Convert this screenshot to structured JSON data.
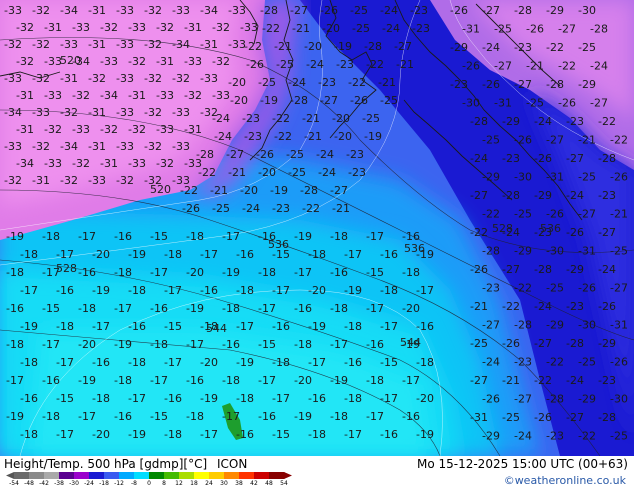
{
  "title_left": "Height/Temp. 500 hPa [gdmp][°C]",
  "model_name": "ICON",
  "title_right": "Mo 15-12-2025 15:00 UTC (00+63)",
  "credit": "©weatheronline.co.uk",
  "colorbar": {
    "ticks": [
      "-54",
      "-48",
      "-42",
      "-38",
      "-30",
      "-24",
      "-18",
      "-12",
      "-8",
      "0",
      "8",
      "12",
      "18",
      "24",
      "30",
      "38",
      "42",
      "48",
      "54"
    ],
    "colors": [
      "#6a6a6a",
      "#8a8a8a",
      "#a9a9a9",
      "#5a0090",
      "#9a00cc",
      "#1a1ad2",
      "#3a5af0",
      "#00aaff",
      "#00ddff",
      "#008800",
      "#44bb00",
      "#aadd00",
      "#ffff00",
      "#ffcc00",
      "#ff8800",
      "#ff3300",
      "#cc0000",
      "#880000"
    ]
  },
  "contour_labels": {
    "pink": [
      "-33",
      "-32",
      "-34",
      "-31",
      "-33",
      "-32",
      "-33",
      "-34",
      "-33",
      "-32",
      "-31",
      "-33",
      "-32",
      "-33",
      "-32",
      "-31",
      "-32",
      "-33",
      "-32",
      "-32",
      "-33",
      "-31"
    ],
    "mid": [
      "-28",
      "-27",
      "-26",
      "-25",
      "-24",
      "-23",
      "-22",
      "-21",
      "-20",
      "-25",
      "-24",
      "-23",
      "-22",
      "-21",
      "-20",
      "-19"
    ],
    "low": [
      "-19",
      "-18",
      "-17",
      "-16",
      "-15",
      "-18",
      "-17",
      "-16",
      "-19",
      "-18",
      "-17",
      "-16",
      "-18",
      "-17",
      "-20"
    ],
    "east": [
      "-26",
      "-27",
      "-28",
      "-29",
      "-30",
      "-31",
      "-25",
      "-26",
      "-27",
      "-28",
      "-29",
      "-24",
      "-23",
      "-22",
      "-25",
      "-26",
      "-27",
      "-21",
      "-22",
      "-24",
      "-23"
    ],
    "height": [
      "544",
      "536",
      "528",
      "520",
      "536",
      "544",
      "528",
      "520",
      "536"
    ]
  }
}
